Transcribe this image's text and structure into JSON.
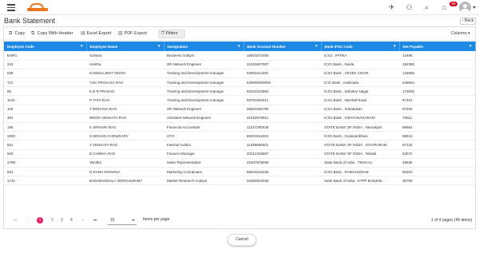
{
  "header": {
    "icons": [
      "menu-icon",
      "logo",
      "tasks-icon",
      "users-icon",
      "search-icon",
      "notifications-icon",
      "profile-avatar"
    ],
    "notification_count": "99"
  },
  "page": {
    "title": "Bank Statement",
    "back_label": "Back"
  },
  "toolbar": {
    "copy": "Copy",
    "copy_with_header": "Copy With Header",
    "excel_export": "Excel Export",
    "pdf_export": "PDF Export",
    "filters": "Filters",
    "columns": "Columns"
  },
  "table": {
    "columns": [
      "Employee Code",
      "Employee Name",
      "Designation",
      "Bank Account Number",
      "Bank IFSC Code",
      "Net Payable"
    ],
    "rows": [
      [
        "EMP1",
        "Suhana",
        "Business Analyst",
        "16901572459",
        "ICICI , PATNA",
        "14496"
      ],
      [
        "242",
        "Haritha",
        "SR Network Engineer",
        "31015507907",
        "ICICI Bank , Noida",
        "192380"
      ],
      [
        "538",
        "KANWALJEET SINGH",
        "Training and Development manager",
        "62901512491",
        "ICICI Bank , VEVEK VIHAR",
        "126556"
      ],
      [
        "712",
        "YSC PRAKASA RAO",
        "Training and Development manager",
        "630000000000",
        "ICIC Bank , Kakinada",
        "246664"
      ],
      [
        "50",
        "K B R PRASAD",
        "Training and Development manager",
        "60401510663",
        "ICICI Bank , Sahakar Nagar",
        "173005"
      ],
      [
        "1144",
        "P TATA RAO",
        "Training and Development manager",
        "93751504011",
        "ICICI Bank , Nevrbal Road",
        "87403"
      ],
      [
        "118",
        "T MOHANA RAO",
        "SR Network Engineer",
        "28001506790",
        "ICICI Bank , Srikakulam",
        "87493"
      ],
      [
        "304",
        "REDDI VENKATA RAO",
        "Assistant Network Engineer",
        "31015078011",
        "ICICI Bank , VIZAYANAGARAM",
        "70011"
      ],
      [
        "185",
        "K SRIHARI RAO",
        "Financial Accountant",
        "11247290038",
        "STATE BANK OF INDIA , Narsakpet",
        "68684"
      ],
      [
        "3300",
        "S MOHAN CHOWDARY",
        "CFO",
        "68201511563",
        "ICICI Bank , Godavarikhani",
        "68613"
      ],
      [
        "651",
        "Y VENKATA RAO",
        "Internal Auditor",
        "11346966501",
        "STATE BANK OF INDIA , ICHAPURAM",
        "67134"
      ],
      [
        "920",
        "B CHINNA RAO",
        "Finance Manager",
        "20212315687",
        "STATE BANK OF INDIA , Tekkali",
        "63272"
      ],
      [
        "2798",
        "Vanitha",
        "Sales Representative",
        "31937978269",
        "State Bank of India , TEKKALI",
        "49635"
      ],
      [
        "651",
        "N RAMA KRISHNA",
        "Marketing Coordinator",
        "68201510336",
        "ICICI Bank , RAMGUNDAM",
        "50404"
      ],
      [
        "1741",
        "BADABANDALA VEERASWAMY",
        "Market Research Analyst",
        "32082923036",
        "State Bank of India , KTPP BANJHE...",
        "36759"
      ]
    ]
  },
  "pagination": {
    "first": "⏮",
    "prev": "‹",
    "pages": [
      "1",
      "2",
      "3",
      "4"
    ],
    "next": "›",
    "last": "⏭",
    "page_size": "15",
    "items_per_page_label": "Items per page",
    "info": "1 of 4 pages (46 items)"
  },
  "footer": {
    "cancel_label": "Cancel"
  }
}
